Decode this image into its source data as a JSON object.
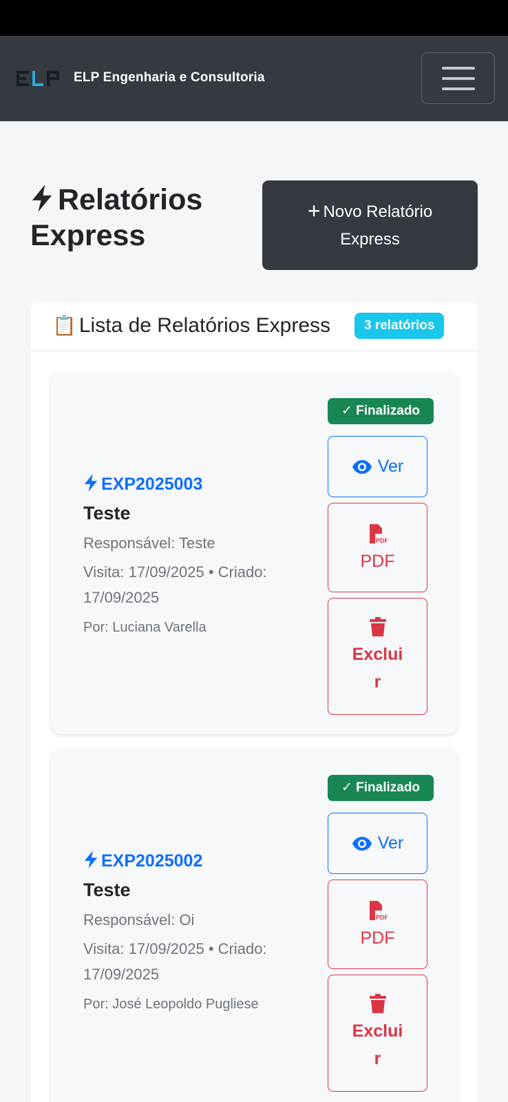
{
  "navbar": {
    "logo_text": "ELP",
    "brand": "ELP Engenharia e Consultoria",
    "menu_icon": "hamburger-icon"
  },
  "header": {
    "icon": "bolt-icon",
    "title": "Relatórios Express",
    "new_button_label": "Novo Relatório Express"
  },
  "list": {
    "icon": "📋",
    "title": "Lista de Relatórios Express",
    "count_label": "3 relatórios"
  },
  "reports": [
    {
      "code": "EXP2025003",
      "title": "Teste",
      "responsible": "Responsável: Teste",
      "dates": "Visita: 17/09/2025 • Criado: 17/09/2025",
      "author": "Por: Luciana Varella",
      "status": "Finalizado",
      "view_label": "Ver",
      "pdf_label": "PDF",
      "delete_label": "Excluir"
    },
    {
      "code": "EXP2025002",
      "title": "Teste",
      "responsible": "Responsável: Oi",
      "dates": "Visita: 17/09/2025 • Criado: 17/09/2025",
      "author": "Por: José Leopoldo Pugliese",
      "status": "Finalizado",
      "view_label": "Ver",
      "pdf_label": "PDF",
      "delete_label": "Excluir"
    }
  ],
  "colors": {
    "navbar": "#343a40",
    "primary": "#0d6efd",
    "danger": "#dc3545",
    "success": "#198754",
    "info": "#19c6ec"
  }
}
